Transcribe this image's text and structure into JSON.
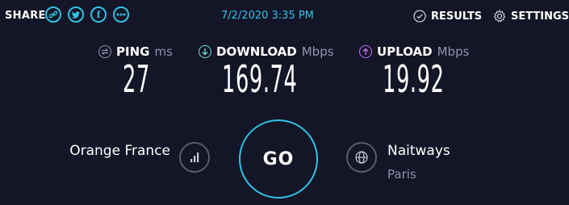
{
  "share": {
    "label": "SHARE",
    "buttons": [
      {
        "name": "link",
        "glyph": "⛓"
      },
      {
        "name": "twitter",
        "glyph": "t"
      },
      {
        "name": "facebook",
        "glyph": "f"
      },
      {
        "name": "more",
        "glyph": "•••"
      }
    ]
  },
  "timestamp": "7/2/2020 3:35 PM",
  "nav": {
    "results_label": "RESULTS",
    "settings_label": "SETTINGS"
  },
  "metrics": {
    "ping": {
      "label": "PING",
      "unit": "ms",
      "value": "27",
      "color": "#9193a8"
    },
    "download": {
      "label": "DOWNLOAD",
      "unit": "Mbps",
      "value": "169.74",
      "color": "#6ce3d4"
    },
    "upload": {
      "label": "UPLOAD",
      "unit": "Mbps",
      "value": "19.92",
      "color": "#bf71ff"
    }
  },
  "isp": {
    "name": "Orange France"
  },
  "go_label": "GO",
  "server": {
    "name": "Naitways",
    "location": "Paris"
  },
  "colors": {
    "accent": "#2fc3e8",
    "background": "#141526"
  }
}
